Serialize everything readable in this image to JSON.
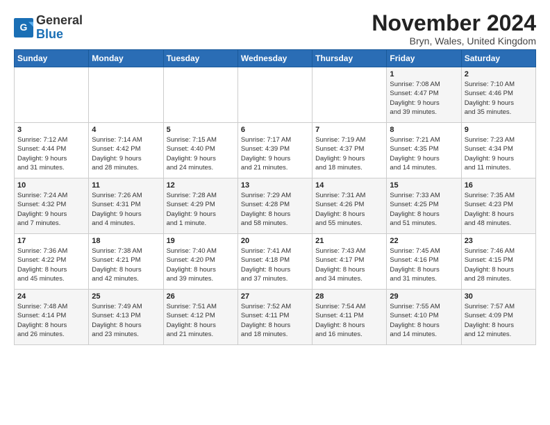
{
  "logo": {
    "line1": "General",
    "line2": "Blue"
  },
  "title": "November 2024",
  "location": "Bryn, Wales, United Kingdom",
  "days_of_week": [
    "Sunday",
    "Monday",
    "Tuesday",
    "Wednesday",
    "Thursday",
    "Friday",
    "Saturday"
  ],
  "weeks": [
    [
      {
        "day": "",
        "info": ""
      },
      {
        "day": "",
        "info": ""
      },
      {
        "day": "",
        "info": ""
      },
      {
        "day": "",
        "info": ""
      },
      {
        "day": "",
        "info": ""
      },
      {
        "day": "1",
        "info": "Sunrise: 7:08 AM\nSunset: 4:47 PM\nDaylight: 9 hours\nand 39 minutes."
      },
      {
        "day": "2",
        "info": "Sunrise: 7:10 AM\nSunset: 4:46 PM\nDaylight: 9 hours\nand 35 minutes."
      }
    ],
    [
      {
        "day": "3",
        "info": "Sunrise: 7:12 AM\nSunset: 4:44 PM\nDaylight: 9 hours\nand 31 minutes."
      },
      {
        "day": "4",
        "info": "Sunrise: 7:14 AM\nSunset: 4:42 PM\nDaylight: 9 hours\nand 28 minutes."
      },
      {
        "day": "5",
        "info": "Sunrise: 7:15 AM\nSunset: 4:40 PM\nDaylight: 9 hours\nand 24 minutes."
      },
      {
        "day": "6",
        "info": "Sunrise: 7:17 AM\nSunset: 4:39 PM\nDaylight: 9 hours\nand 21 minutes."
      },
      {
        "day": "7",
        "info": "Sunrise: 7:19 AM\nSunset: 4:37 PM\nDaylight: 9 hours\nand 18 minutes."
      },
      {
        "day": "8",
        "info": "Sunrise: 7:21 AM\nSunset: 4:35 PM\nDaylight: 9 hours\nand 14 minutes."
      },
      {
        "day": "9",
        "info": "Sunrise: 7:23 AM\nSunset: 4:34 PM\nDaylight: 9 hours\nand 11 minutes."
      }
    ],
    [
      {
        "day": "10",
        "info": "Sunrise: 7:24 AM\nSunset: 4:32 PM\nDaylight: 9 hours\nand 7 minutes."
      },
      {
        "day": "11",
        "info": "Sunrise: 7:26 AM\nSunset: 4:31 PM\nDaylight: 9 hours\nand 4 minutes."
      },
      {
        "day": "12",
        "info": "Sunrise: 7:28 AM\nSunset: 4:29 PM\nDaylight: 9 hours\nand 1 minute."
      },
      {
        "day": "13",
        "info": "Sunrise: 7:29 AM\nSunset: 4:28 PM\nDaylight: 8 hours\nand 58 minutes."
      },
      {
        "day": "14",
        "info": "Sunrise: 7:31 AM\nSunset: 4:26 PM\nDaylight: 8 hours\nand 55 minutes."
      },
      {
        "day": "15",
        "info": "Sunrise: 7:33 AM\nSunset: 4:25 PM\nDaylight: 8 hours\nand 51 minutes."
      },
      {
        "day": "16",
        "info": "Sunrise: 7:35 AM\nSunset: 4:23 PM\nDaylight: 8 hours\nand 48 minutes."
      }
    ],
    [
      {
        "day": "17",
        "info": "Sunrise: 7:36 AM\nSunset: 4:22 PM\nDaylight: 8 hours\nand 45 minutes."
      },
      {
        "day": "18",
        "info": "Sunrise: 7:38 AM\nSunset: 4:21 PM\nDaylight: 8 hours\nand 42 minutes."
      },
      {
        "day": "19",
        "info": "Sunrise: 7:40 AM\nSunset: 4:20 PM\nDaylight: 8 hours\nand 39 minutes."
      },
      {
        "day": "20",
        "info": "Sunrise: 7:41 AM\nSunset: 4:18 PM\nDaylight: 8 hours\nand 37 minutes."
      },
      {
        "day": "21",
        "info": "Sunrise: 7:43 AM\nSunset: 4:17 PM\nDaylight: 8 hours\nand 34 minutes."
      },
      {
        "day": "22",
        "info": "Sunrise: 7:45 AM\nSunset: 4:16 PM\nDaylight: 8 hours\nand 31 minutes."
      },
      {
        "day": "23",
        "info": "Sunrise: 7:46 AM\nSunset: 4:15 PM\nDaylight: 8 hours\nand 28 minutes."
      }
    ],
    [
      {
        "day": "24",
        "info": "Sunrise: 7:48 AM\nSunset: 4:14 PM\nDaylight: 8 hours\nand 26 minutes."
      },
      {
        "day": "25",
        "info": "Sunrise: 7:49 AM\nSunset: 4:13 PM\nDaylight: 8 hours\nand 23 minutes."
      },
      {
        "day": "26",
        "info": "Sunrise: 7:51 AM\nSunset: 4:12 PM\nDaylight: 8 hours\nand 21 minutes."
      },
      {
        "day": "27",
        "info": "Sunrise: 7:52 AM\nSunset: 4:11 PM\nDaylight: 8 hours\nand 18 minutes."
      },
      {
        "day": "28",
        "info": "Sunrise: 7:54 AM\nSunset: 4:11 PM\nDaylight: 8 hours\nand 16 minutes."
      },
      {
        "day": "29",
        "info": "Sunrise: 7:55 AM\nSunset: 4:10 PM\nDaylight: 8 hours\nand 14 minutes."
      },
      {
        "day": "30",
        "info": "Sunrise: 7:57 AM\nSunset: 4:09 PM\nDaylight: 8 hours\nand 12 minutes."
      }
    ]
  ]
}
